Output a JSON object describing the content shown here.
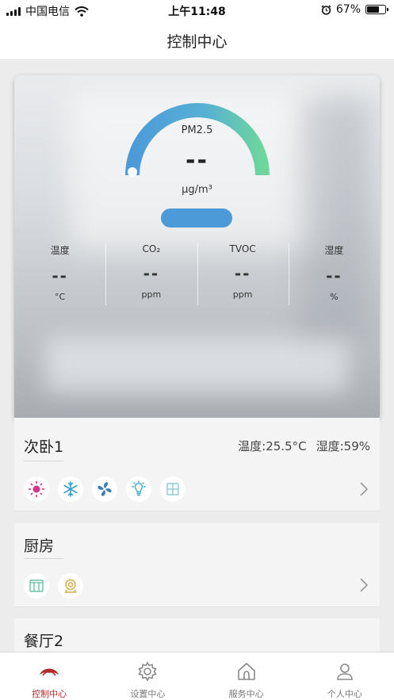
{
  "status_bar": {
    "carrier": "中国电信",
    "time": "上午11:48",
    "battery": "67%",
    "battery_level": 0.67
  },
  "nav": {
    "title": "控制中心"
  },
  "air": {
    "pm_label": "PM2.5",
    "pm_value": "--",
    "pm_unit": "μg/m³",
    "metrics": [
      {
        "label": "温度",
        "value": "--",
        "unit": "°C"
      },
      {
        "label": "CO₂",
        "value": "--",
        "unit": "ppm"
      },
      {
        "label": "TVOC",
        "value": "--",
        "unit": "ppm"
      },
      {
        "label": "湿度",
        "value": "--",
        "unit": "%"
      }
    ]
  },
  "rooms": [
    {
      "name": "次卧1",
      "temperature": "温度:25.5°C",
      "humidity": "湿度:59%",
      "devices": [
        "sun-icon",
        "snowflake-icon",
        "fan-icon",
        "lightbulb-icon",
        "window-icon"
      ]
    },
    {
      "name": "厨房",
      "devices": [
        "curtain-icon",
        "camera-icon"
      ]
    },
    {
      "name": "餐厅2"
    }
  ],
  "tabs": [
    {
      "label": "控制中心",
      "icon": "control-center-icon",
      "active": true
    },
    {
      "label": "设置中心",
      "icon": "gear-icon",
      "active": false
    },
    {
      "label": "服务中心",
      "icon": "service-house-icon",
      "active": false
    },
    {
      "label": "个人中心",
      "icon": "person-icon",
      "active": false
    }
  ],
  "colors": {
    "accent_active": "#b22a2a",
    "gauge_start": "#4d9ad9",
    "gauge_end": "#6dd69c",
    "pill": "#4d9ad9",
    "heater": "#d0368a",
    "cool": "#3aa0c8"
  }
}
